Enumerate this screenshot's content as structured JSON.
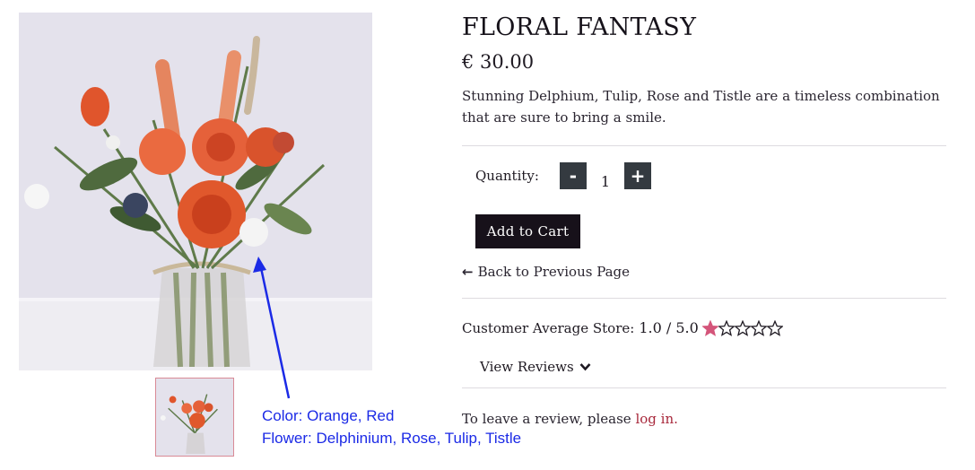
{
  "product": {
    "title": "FLORAL FANTASY",
    "price": "€ 30.00",
    "description": "Stunning Delphium, Tulip, Rose and Tistle are a timeless combination that are sure to bring a smile."
  },
  "quantity": {
    "label": "Quantity:",
    "decrement_label": "-",
    "increment_label": "+",
    "value": "1"
  },
  "cart": {
    "add_label": "Add to Cart"
  },
  "navigation": {
    "back_label": "Back to Previous Page",
    "back_icon": "arrow-left-icon"
  },
  "rating": {
    "label": "Customer Average Store:",
    "value_text": "1.0 / 5.0",
    "score": 1,
    "max": 5,
    "filled_color": "#d4557a"
  },
  "reviews": {
    "toggle_label": "View Reviews",
    "leave_prefix": "To leave a review, please ",
    "login_label": "log in."
  },
  "annotation": {
    "color_line": "Color: Orange, Red",
    "flower_line": "Flower: Delphinium, Rose, Tulip, Tistle",
    "color": "#1b2ae6"
  },
  "colors": {
    "accent_link": "#a8283b",
    "button_dark": "#17111a",
    "qty_button": "#343a40"
  }
}
